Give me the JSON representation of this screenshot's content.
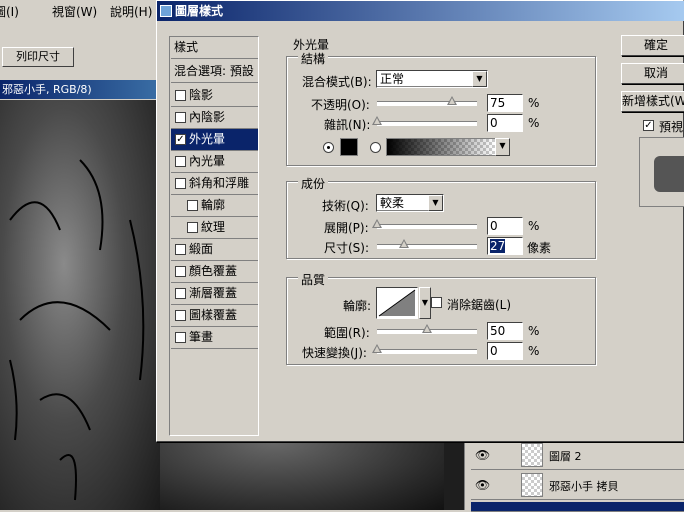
{
  "app": {
    "menus": [
      "圖(I)",
      "視窗(W)",
      "說明(H)"
    ],
    "toolbar_button": "列印尺寸",
    "doc_title": "邪惡小手, RGB/8)"
  },
  "dialog": {
    "title": "圖層樣式",
    "sidebar": {
      "header": "樣式",
      "blend_options": "混合選項: 預設",
      "items": [
        {
          "label": "陰影",
          "checked": false,
          "indent": false
        },
        {
          "label": "內陰影",
          "checked": false,
          "indent": false
        },
        {
          "label": "外光暈",
          "checked": true,
          "indent": false,
          "selected": true
        },
        {
          "label": "內光暈",
          "checked": false,
          "indent": false
        },
        {
          "label": "斜角和浮雕",
          "checked": false,
          "indent": false
        },
        {
          "label": "輪廓",
          "checked": false,
          "indent": true
        },
        {
          "label": "紋理",
          "checked": false,
          "indent": true
        },
        {
          "label": "緞面",
          "checked": false,
          "indent": false
        },
        {
          "label": "顏色覆蓋",
          "checked": false,
          "indent": false
        },
        {
          "label": "漸層覆蓋",
          "checked": false,
          "indent": false
        },
        {
          "label": "圖樣覆蓋",
          "checked": false,
          "indent": false
        },
        {
          "label": "筆畫",
          "checked": false,
          "indent": false
        }
      ]
    },
    "outer_glow": {
      "group_title": "外光暈",
      "structure": {
        "title": "結構",
        "blend_mode_label": "混合模式(B):",
        "blend_mode_value": "正常",
        "opacity_label": "不透明(O):",
        "opacity_value": "75",
        "opacity_unit": "%",
        "noise_label": "雜訊(N):",
        "noise_value": "0",
        "noise_unit": "%",
        "color": "#000000"
      },
      "elements": {
        "title": "成份",
        "technique_label": "技術(Q):",
        "technique_value": "較柔",
        "spread_label": "展開(P):",
        "spread_value": "0",
        "spread_unit": "%",
        "size_label": "尺寸(S):",
        "size_value": "27",
        "size_unit": "像素"
      },
      "quality": {
        "title": "品質",
        "contour_label": "輪廓:",
        "antialias_label": "消除鋸齒(L)",
        "range_label": "範圍(R):",
        "range_value": "50",
        "range_unit": "%",
        "jitter_label": "快速變換(J):",
        "jitter_value": "0",
        "jitter_unit": "%"
      },
      "slider_levels": {
        "opacity": 75,
        "noise": 0,
        "spread": 0,
        "size": 27,
        "range": 50,
        "jitter": 0
      }
    },
    "buttons": {
      "ok": "確定",
      "cancel": "取消",
      "new_style": "新增樣式(W)...",
      "preview": "預視(V)"
    }
  },
  "layers": [
    {
      "name": "圖層 2",
      "selected": false
    },
    {
      "name": "邪惡小手 拷貝",
      "selected": false
    }
  ]
}
